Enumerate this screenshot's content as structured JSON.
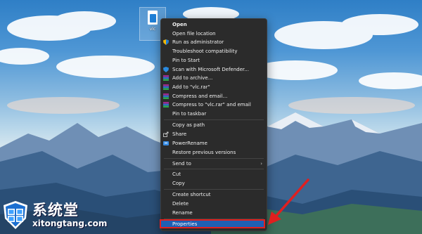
{
  "desktop": {
    "icon_label": "vlc"
  },
  "context_menu": {
    "items": [
      {
        "label": "Open",
        "icon": "none",
        "bold": true
      },
      {
        "label": "Open file location",
        "icon": "none"
      },
      {
        "label": "Run as administrator",
        "icon": "shield-icon"
      },
      {
        "label": "Troubleshoot compatibility",
        "icon": "none"
      },
      {
        "label": "Pin to Start",
        "icon": "none"
      },
      {
        "label": "Scan with Microsoft Defender...",
        "icon": "defender-icon"
      },
      {
        "label": "Add to archive...",
        "icon": "winrar-icon"
      },
      {
        "label": "Add to \"vlc.rar\"",
        "icon": "winrar-icon"
      },
      {
        "label": "Compress and email...",
        "icon": "winrar-icon"
      },
      {
        "label": "Compress to \"vlc.rar\" and email",
        "icon": "winrar-icon"
      },
      {
        "label": "Pin to taskbar",
        "icon": "none"
      },
      {
        "label": "Copy as path",
        "icon": "none"
      },
      {
        "label": "Share",
        "icon": "share-icon"
      },
      {
        "label": "PowerRename",
        "icon": "powerrename-icon"
      },
      {
        "label": "Restore previous versions",
        "icon": "none"
      },
      {
        "label": "Send to",
        "icon": "none",
        "submenu": true
      },
      {
        "label": "Cut",
        "icon": "none"
      },
      {
        "label": "Copy",
        "icon": "none"
      },
      {
        "label": "Create shortcut",
        "icon": "none"
      },
      {
        "label": "Delete",
        "icon": "none"
      },
      {
        "label": "Rename",
        "icon": "none"
      },
      {
        "label": "Properties",
        "icon": "none",
        "highlighted": true
      }
    ],
    "submenu_arrow": "›"
  },
  "colors": {
    "menu_bg": "#2b2b2b",
    "highlight": "#1e5fb4",
    "annotation_red": "#e11f1f"
  },
  "watermark": {
    "brand_cn": "系统堂",
    "site": "xitongtang.com"
  }
}
